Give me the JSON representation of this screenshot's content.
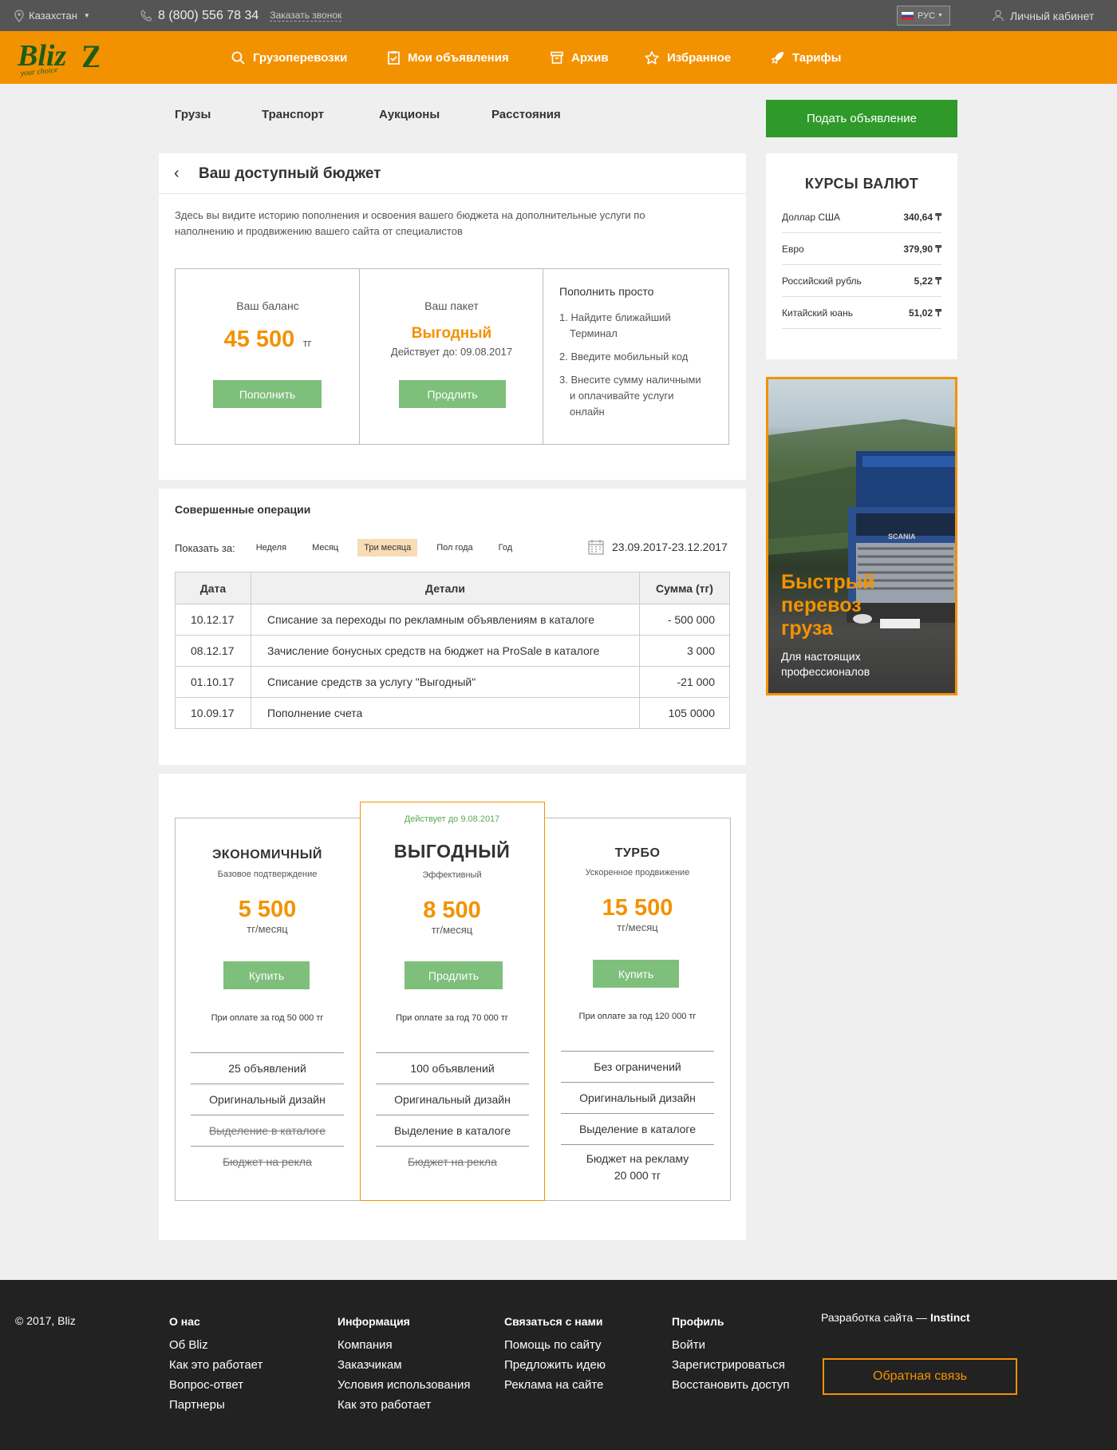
{
  "topbar": {
    "region": "Казахстан",
    "phone": "8 (800) 556 78 34",
    "callback": "Заказать звонок",
    "lang": "РУС",
    "cabinet": "Личный кабинет"
  },
  "logo": {
    "main": "Bliz",
    "tagline": "your choice"
  },
  "nav": [
    "Грузоперевозки",
    "Мои объявления",
    "Архив",
    "Избранное",
    "Тарифы"
  ],
  "subnav": [
    "Грузы",
    "Транспорт",
    "Аукционы",
    "Расстояния"
  ],
  "post_button": "Подать объявление",
  "budget": {
    "title": "Ваш доступный бюджет",
    "desc1": "Здесь вы видите историю пополнения и освоения вашего бюджета на дополнительные услуги по",
    "desc2": "наполнению и продвижению вашего сайта от специалистов",
    "balance_label": "Ваш баланс",
    "balance_value": "45 500",
    "balance_unit": "тг",
    "topup": "Пополнить",
    "package_label": "Ваш пакет",
    "package_name": "Выгодный",
    "package_valid": "Действует до: 09.08.2017",
    "extend": "Продлить",
    "easy_title": "Пополнить просто",
    "steps": [
      [
        "1. Найдите ближайший",
        "Терминал"
      ],
      [
        "2. Введите мобильный код"
      ],
      [
        "3. Внесите сумму наличными",
        "и оплачивайте услуги",
        "онлайн"
      ]
    ]
  },
  "ops": {
    "title": "Совершенные операции",
    "show_label": "Показать за:",
    "periods": [
      "Неделя",
      "Месяц",
      "Три месяца",
      "Пол года",
      "Год"
    ],
    "active_period": "Три месяца",
    "range": "23.09.2017-23.12.2017",
    "headers": [
      "Дата",
      "Детали",
      "Сумма (тг)"
    ],
    "rows": [
      [
        "10.12.17",
        "Списание за переходы по рекламным объявлениям в каталоге",
        "- 500 000"
      ],
      [
        "08.12.17",
        "Зачисление бонусных средств на бюджет на ProSale в каталоге",
        "3 000"
      ],
      [
        "01.10.17",
        "Списание средств за услугу \"Выгодный\"",
        "-21 000"
      ],
      [
        "10.09.17",
        "Пополнение счета",
        "105 0000"
      ]
    ]
  },
  "plans": [
    {
      "name": "ЭКОНОМИЧНЫЙ",
      "sub": "Базовое подтверждение",
      "price": "5 500",
      "unit": "тг/месяц",
      "button": "Купить",
      "yearly": "При оплате за год 50 000 тг",
      "features": [
        [
          "25 объявлений",
          false
        ],
        [
          "Оригинальный дизайн",
          false
        ],
        [
          "Выделение в каталоге",
          true
        ],
        [
          "Бюджет на рекла",
          true
        ]
      ]
    },
    {
      "name": "ВЫГОДНЫЙ",
      "sub": "Эффективный",
      "price": "8 500",
      "unit": "тг/месяц",
      "button": "Продлить",
      "yearly": "При оплате за год 70 000 тг",
      "valid": "Действует до 9.08.2017",
      "features": [
        [
          "100 объявлений",
          false
        ],
        [
          "Оригинальный дизайн",
          false
        ],
        [
          "Выделение в каталоге",
          false
        ],
        [
          "Бюджет на рекла",
          true
        ]
      ]
    },
    {
      "name": "ТУРБО",
      "sub": "Ускоренное продвижение",
      "price": "15 500",
      "unit": "тг/месяц",
      "button": "Купить",
      "yearly": "При оплате за год 120 000 тг",
      "features": [
        [
          "Без ограничений",
          false
        ],
        [
          "Оригинальный дизайн",
          false
        ],
        [
          "Выделение в каталоге",
          false
        ],
        [
          "Бюджет на рекламу",
          false
        ]
      ],
      "extra": "20 000 тг"
    }
  ],
  "rates": {
    "title": "КУРСЫ ВАЛЮТ",
    "items": [
      [
        "Доллар США",
        "340,64 ₸"
      ],
      [
        "Евро",
        "379,90 ₸"
      ],
      [
        "Российский рубль",
        "5,22 ₸"
      ],
      [
        "Китайский юань",
        "51,02 ₸"
      ]
    ]
  },
  "ad": {
    "title1": "Быстрый",
    "title2": "перевоз",
    "title3": "груза",
    "sub1": "Для настоящих",
    "sub2": "профессионалов",
    "plate": "SCANIA"
  },
  "footer": {
    "copyright": "© 2017, Bliz",
    "cols": [
      {
        "title": "О нас",
        "links": [
          "Об Bliz",
          "Как это работает",
          "Вопрос-ответ",
          "Партнеры"
        ]
      },
      {
        "title": "Информация",
        "links": [
          "Компания",
          "Заказчикам",
          "Условия использования",
          "Как это работает"
        ]
      },
      {
        "title": "Связаться с нами",
        "links": [
          "Помощь по сайту",
          "Предложить идею",
          "Реклама на сайте"
        ]
      },
      {
        "title": "Профиль",
        "links": [
          "Войти",
          "Зарегистрироваться",
          "Восстановить доступ"
        ]
      }
    ],
    "dev_prefix": "Разработка сайта — ",
    "dev_name": "Instinct",
    "feedback": "Обратная связь"
  },
  "colors": {
    "orange": "#f39200",
    "green": "#2f9a2a",
    "light_green": "#7ebf7b",
    "dark": "#222222"
  }
}
